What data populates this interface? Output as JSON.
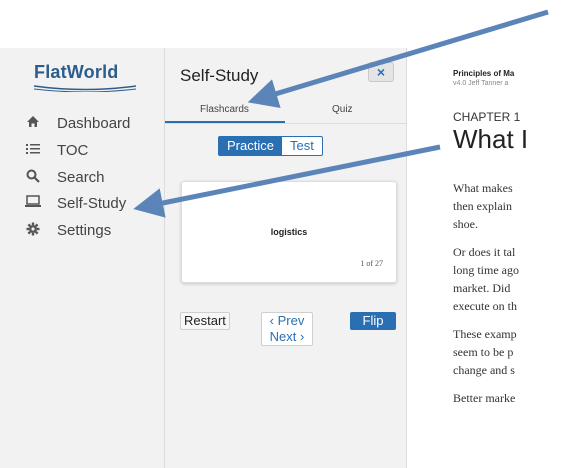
{
  "sidebar": {
    "logo": "FlatWorld",
    "items": [
      {
        "label": "Dashboard",
        "icon": "home-icon"
      },
      {
        "label": "TOC",
        "icon": "list-icon"
      },
      {
        "label": "Search",
        "icon": "search-icon"
      },
      {
        "label": "Self-Study",
        "icon": "laptop-icon"
      },
      {
        "label": "Settings",
        "icon": "gear-icon"
      }
    ]
  },
  "panel": {
    "title": "Self-Study",
    "close_label": "×",
    "tabs": [
      "Flashcards",
      "Quiz"
    ],
    "active_tab": "Flashcards",
    "modes": [
      "Practice",
      "Test"
    ],
    "active_mode": "Practice",
    "card": {
      "term": "logistics",
      "count": "1 of 27"
    },
    "buttons": {
      "restart": "Restart",
      "prev": "‹ Prev",
      "next": "Next ›",
      "flip": "Flip"
    }
  },
  "reader": {
    "book_title": "Principles of Ma",
    "book_meta": "v4.0  Jeff Tanner a",
    "chapter_label": "CHAPTER 1",
    "chapter_title": "What I",
    "lines": [
      "What makes",
      "then explain",
      "shoe.",
      "Or does it tal",
      "long time ago",
      "market. Did",
      "execute on th",
      "These examp",
      "seem to be p",
      "change and s",
      "Better marke"
    ]
  },
  "colors": {
    "accent": "#2b6fb3",
    "arrow": "#5b84b8",
    "logo": "#2e5d8c"
  }
}
